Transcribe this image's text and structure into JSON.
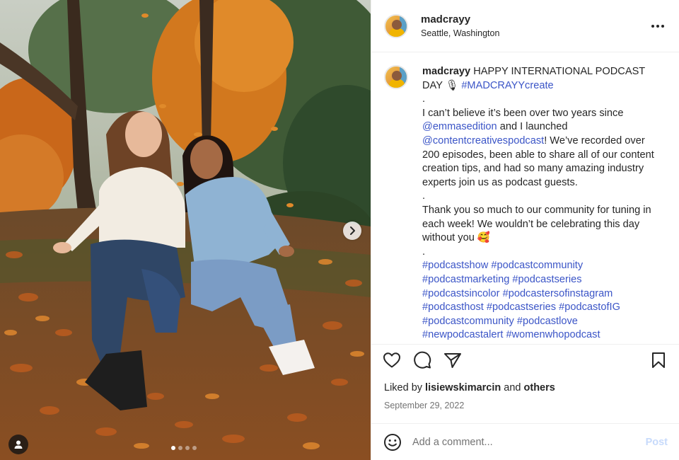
{
  "post": {
    "username": "madcrayy",
    "location": "Seattle, Washington",
    "caption": {
      "username": "madcrayy",
      "line1": "HAPPY INTERNATIONAL PODCAST DAY 🎙",
      "hashtag_main": "#MADCRAYYcreate",
      "dot1": ".",
      "p1_a": "I can’t believe it’s been over two years since",
      "mention1": "@emmasedition",
      "p1_b": "and I launched",
      "mention2": "@contentcreativespodcast",
      "p1_c": "! We’ve recorded over 200 episodes, been able to share all of our content creation tips, and had so many amazing industry experts join us as podcast guests.",
      "dot2": ".",
      "p2": "Thank you so much to our community for tuning in each week! We wouldn’t be celebrating this day without you 🥰",
      "dot3": ".",
      "hashtags": [
        "#podcastshow",
        "#podcastcommunity",
        "#podcastmarketing",
        "#podcastseries",
        "#podcastsincolor",
        "#podcastersofinstagram",
        "#podcasthost",
        "#podcastseries",
        "#podcastofIG",
        "#podcastcommunity",
        "#podcastlove",
        "#newpodcastalert",
        "#womenwhopodcast"
      ]
    },
    "likes": {
      "prefix": "Liked by",
      "user": "lisiewskimarcin",
      "conj": "and",
      "others": "others"
    },
    "date": "September 29, 2022",
    "comment": {
      "placeholder": "Add a comment...",
      "post_label": "Post"
    },
    "carousel": {
      "total": 4,
      "active": 1
    }
  },
  "colors": {
    "link": "#3b55c7",
    "post_button": "#c7dafb",
    "secondary_text": "#737373"
  },
  "icons": [
    "more-options-icon",
    "heart-icon",
    "comment-icon",
    "share-icon",
    "bookmark-icon",
    "emoji-icon",
    "chevron-right-icon",
    "user-tag-icon"
  ]
}
